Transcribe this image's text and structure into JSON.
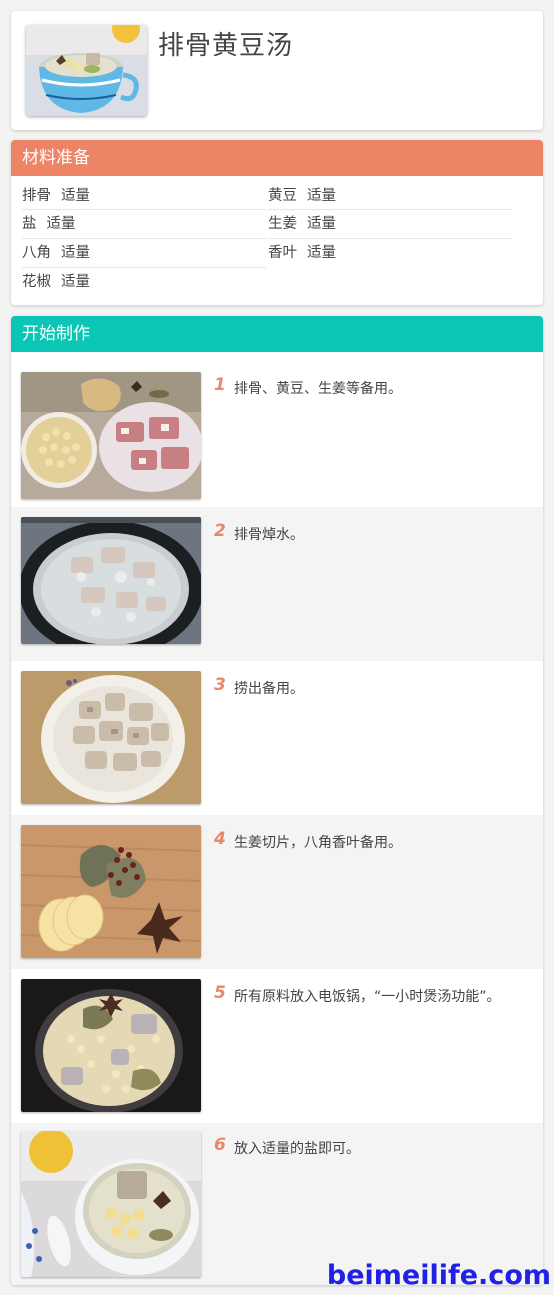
{
  "recipe": {
    "title": "排骨黄豆汤",
    "cover_image": "bowl-of-soup-photo"
  },
  "ingredients_section": {
    "header": "材料准备",
    "items": [
      {
        "name": "排骨",
        "qty": "适量"
      },
      {
        "name": "黄豆",
        "qty": "适量"
      },
      {
        "name": "盐",
        "qty": "适量"
      },
      {
        "name": "生姜",
        "qty": "适量"
      },
      {
        "name": "八角",
        "qty": "适量"
      },
      {
        "name": "香叶",
        "qty": "适量"
      },
      {
        "name": "花椒",
        "qty": "适量"
      }
    ]
  },
  "steps_section": {
    "header": "开始制作",
    "steps": [
      {
        "num": "1",
        "text": "排骨、黄豆、生姜等备用。",
        "image": "raw-ingredients-photo"
      },
      {
        "num": "2",
        "text": "排骨焯水。",
        "image": "blanching-pan-photo"
      },
      {
        "num": "3",
        "text": "捞出备用。",
        "image": "blanched-ribs-plate-photo"
      },
      {
        "num": "4",
        "text": "生姜切片，八角香叶备用。",
        "image": "spices-board-photo"
      },
      {
        "num": "5",
        "text": "所有原料放入电饭锅，“一小时煲汤功能”。",
        "image": "rice-cooker-photo"
      },
      {
        "num": "6",
        "text": "放入适量的盐即可。",
        "image": "finished-soup-photo"
      }
    ]
  },
  "watermark": "beimeilife.com",
  "colors": {
    "ingredients_header": "#ee8466",
    "steps_header": "#0bc6b4",
    "step_number": "#e8876a",
    "watermark": "#2121e6"
  }
}
